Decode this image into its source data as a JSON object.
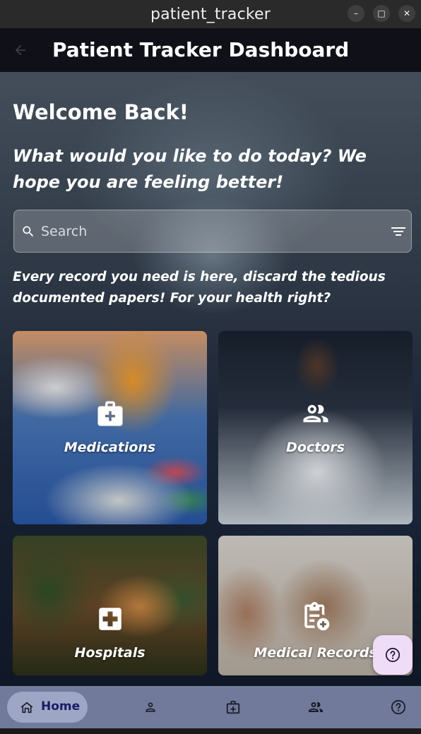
{
  "window": {
    "title": "patient_tracker",
    "minimize_glyph": "–",
    "maximize_glyph": "□",
    "close_glyph": "✕"
  },
  "appbar": {
    "title": "Patient Tracker Dashboard",
    "back_icon": "arrow-back-icon"
  },
  "main": {
    "welcome": "Welcome Back!",
    "tagline": "What would you like to do today? We hope you are feeling better!",
    "search": {
      "placeholder": "Search",
      "value": ""
    },
    "subtext": "Every record you need is here, discard the tedious documented papers! For your health right?"
  },
  "tiles": [
    {
      "label": "Medications",
      "icon": "medical-bag-icon"
    },
    {
      "label": "Doctors",
      "icon": "people-icon"
    },
    {
      "label": "Hospitals",
      "icon": "hospital-cross-icon"
    },
    {
      "label": "Medical Records",
      "icon": "clipboard-add-icon"
    }
  ],
  "fab": {
    "icon": "help-icon"
  },
  "bottom_nav": {
    "items": [
      {
        "label": "Home",
        "icon": "home-icon",
        "selected": true
      },
      {
        "icon": "person-icon"
      },
      {
        "icon": "medical-bag-icon"
      },
      {
        "icon": "people-icon"
      },
      {
        "icon": "help-icon"
      }
    ]
  },
  "colors": {
    "appbar_bg": "#101018",
    "bottom_nav_bg": "#717a9a",
    "nav_selected_bg": "#9ea6c6",
    "nav_selected_text": "#1a1d64",
    "fab_bg": "#efdcf6"
  }
}
